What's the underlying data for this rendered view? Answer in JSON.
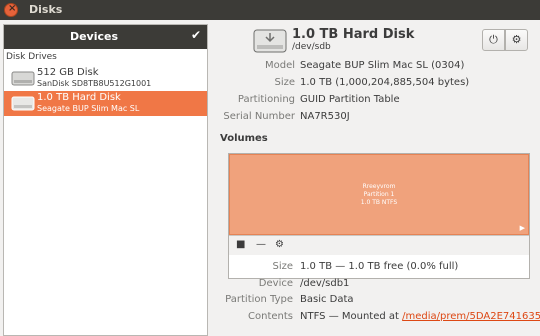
{
  "window": {
    "title": "Disks"
  },
  "sidebar": {
    "header": "Devices",
    "section_label": "Disk Drives",
    "drives": [
      {
        "name": "512 GB Disk",
        "model": "SanDisk SD8TB8U512G1001"
      },
      {
        "name": "1.0 TB Hard Disk",
        "model": "Seagate BUP Slim Mac SL",
        "selected": true
      }
    ]
  },
  "disk": {
    "title": "1.0 TB Hard Disk",
    "path": "/dev/sdb",
    "props": [
      {
        "key": "Model",
        "value": "Seagate BUP Slim Mac SL (0304)"
      },
      {
        "key": "Size",
        "value": "1.0 TB (1,000,204,885,504 bytes)"
      },
      {
        "key": "Partitioning",
        "value": "GUID Partition Table"
      },
      {
        "key": "Serial Number",
        "value": "NA7R530J"
      }
    ]
  },
  "volumes": {
    "title": "Volumes",
    "partition": {
      "line1": "Rreeyvrom",
      "line2": "Partition 1",
      "line3": "1.0 TB NTFS"
    },
    "props": [
      {
        "key": "Size",
        "value": "1.0 TB — 1.0 TB free (0.0% full)"
      },
      {
        "key": "Device",
        "value": "/dev/sdb1"
      },
      {
        "key": "Partition Type",
        "value": "Basic Data"
      },
      {
        "key": "Contents",
        "value_prefix": "NTFS — Mounted at ",
        "link": "/media/prem/5DA2E741635..."
      }
    ]
  },
  "colors": {
    "accent": "#f07746",
    "partition": "#f0a27c",
    "titlebar": "#3c3b37"
  }
}
